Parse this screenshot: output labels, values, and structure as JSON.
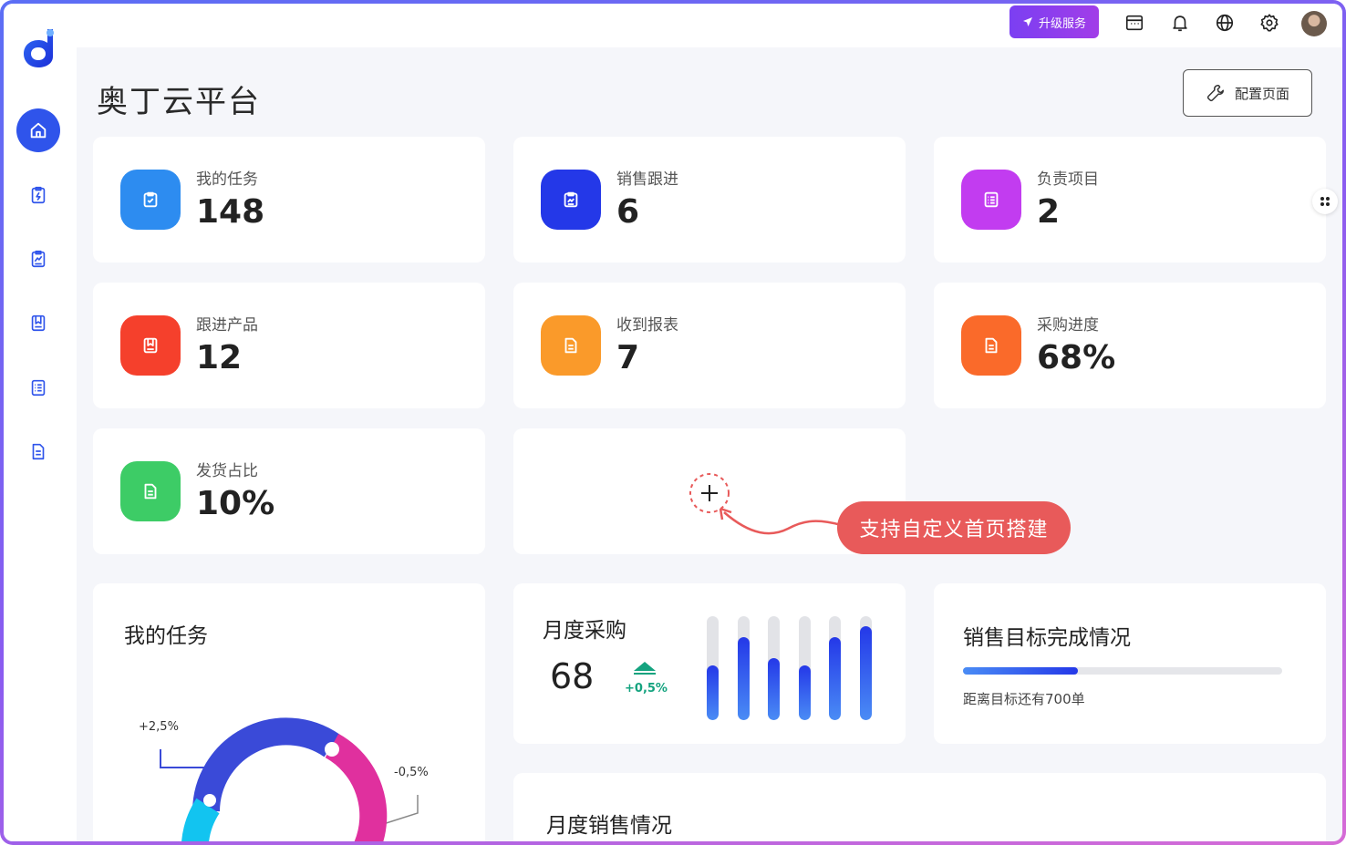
{
  "app": {
    "title": "奥丁云平台",
    "config_label": "配置页面",
    "upgrade_label": "升级服务"
  },
  "sidebar": {
    "items": [
      {
        "name": "home-icon",
        "active": true
      },
      {
        "name": "task-clipboard-icon",
        "active": false
      },
      {
        "name": "sales-chart-icon",
        "active": false
      },
      {
        "name": "bookmark-box-icon",
        "active": false
      },
      {
        "name": "list-icon",
        "active": false
      },
      {
        "name": "document-icon",
        "active": false
      }
    ]
  },
  "topbar": {
    "icons": [
      "calendar-icon",
      "bell-icon",
      "globe-icon",
      "gear-icon",
      "avatar"
    ]
  },
  "stats": [
    {
      "label": "我的任务",
      "value": "148",
      "color": "#2d8cf0",
      "icon": "clipboard-check-icon"
    },
    {
      "label": "销售跟进",
      "value": "6",
      "color": "#2438e8",
      "icon": "clipboard-chart-icon"
    },
    {
      "label": "负责项目",
      "value": "2",
      "color": "#c23cf0",
      "icon": "list-icon"
    },
    {
      "label": "跟进产品",
      "value": "12",
      "color": "#f5402c",
      "icon": "bookmark-box-icon"
    },
    {
      "label": "收到报表",
      "value": "7",
      "color": "#fa9a2a",
      "icon": "document-icon"
    },
    {
      "label": "采购进度",
      "value": "68%",
      "color": "#fa6a2a",
      "icon": "document-icon"
    },
    {
      "label": "发货占比",
      "value": "10%",
      "color": "#3dcc66",
      "icon": "document-icon"
    }
  ],
  "custom": {
    "tooltip": "支持自定义首页搭建"
  },
  "my_tasks_panel": {
    "title": "我的任务",
    "left_delta": "+2,5%",
    "right_delta": "-0,5%"
  },
  "monthly_purchase": {
    "title": "月度采购",
    "value": "68",
    "delta": "+0,5%",
    "bar_fill": [
      0.53,
      0.8,
      0.6,
      0.53,
      0.8,
      0.9
    ]
  },
  "sales_target": {
    "title": "销售目标完成情况",
    "subtitle": "距离目标还有700单",
    "progress": 0.36
  },
  "monthly_sales": {
    "title": "月度销售情况"
  },
  "colors": {
    "primary": "#2f54eb",
    "accent_red": "#e85a5a",
    "up_green": "#14a37f"
  }
}
